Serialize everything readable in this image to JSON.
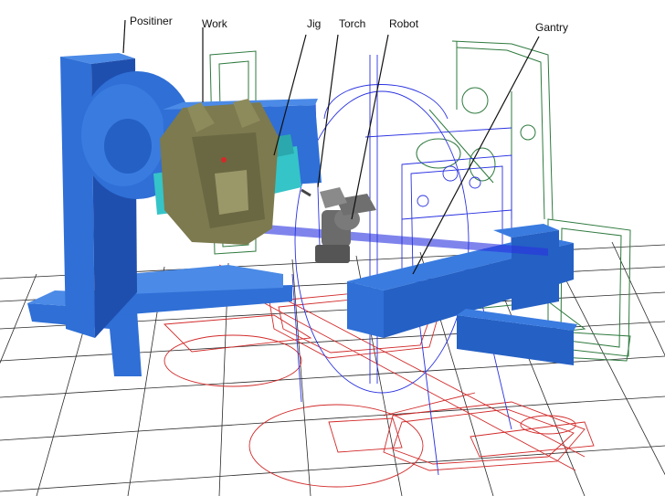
{
  "labels": {
    "positioner": "Positiner",
    "work": "Work",
    "jig": "Jig",
    "torch": "Torch",
    "robot": "Robot",
    "gantry": "Gantry"
  },
  "colors": {
    "background": "#ffffff",
    "grid": "#2a2a2a",
    "positioner_blue": "#2f6fd6",
    "positioner_shadow": "#1f4fae",
    "work_olive": "#7c7a4e",
    "jig_cyan": "#35c4c8",
    "robot_gray": "#606060",
    "wire_red": "#d22a2a",
    "wire_blue": "#2a32e0",
    "wire_green": "#2e7a3e",
    "leader_line": "#111111"
  },
  "icons": [
    "positioner",
    "workpiece",
    "jig",
    "torch",
    "robot-arm",
    "gantry-beam"
  ]
}
